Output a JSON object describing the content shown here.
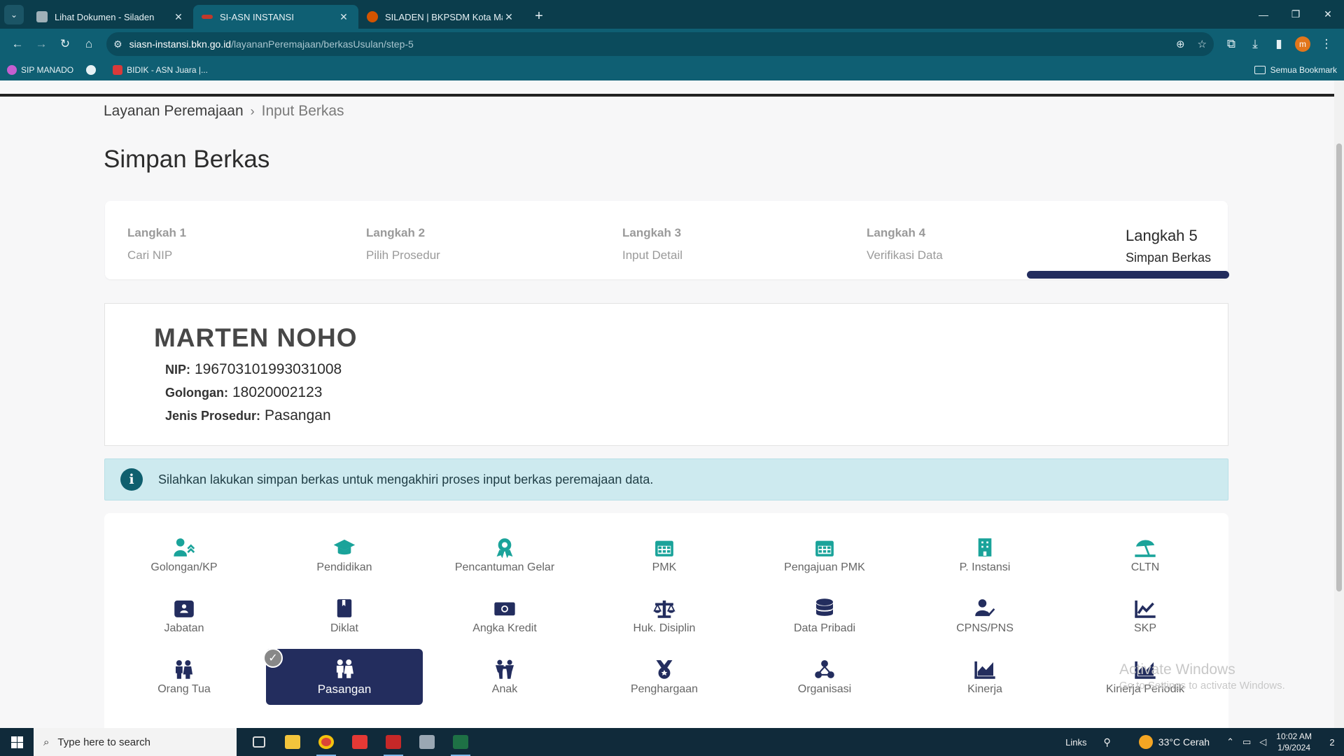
{
  "browser": {
    "tabs": [
      {
        "title": "Lihat Dokumen - Siladen",
        "active": false,
        "favicon_color": "#9fb0b8"
      },
      {
        "title": "SI-ASN INSTANSI",
        "active": true,
        "favicon_color": "#c0392b"
      },
      {
        "title": "SILADEN | BKPSDM Kota Manado",
        "active": false,
        "favicon_color": "#d35400"
      }
    ],
    "url_host": "siasn-instansi.bkn.go.id",
    "url_path": "/layananPeremajaan/berkasUsulan/step-5",
    "profile_initial": "m",
    "bookmarks": [
      {
        "label": "SIP MANADO",
        "color": "#c55fd0"
      },
      {
        "label": "",
        "color": "#e6f1f4"
      },
      {
        "label": "BIDIK - ASN Juara |...",
        "color": "#d83a3a"
      }
    ],
    "bookmarks_folder": "Semua Bookmark"
  },
  "breadcrumb": {
    "link": "Layanan Peremajaan",
    "current": "Input Berkas"
  },
  "page_title": "Simpan Berkas",
  "steps": [
    {
      "num": "Langkah 1",
      "label": "Cari NIP",
      "active": false
    },
    {
      "num": "Langkah 2",
      "label": "Pilih Prosedur",
      "active": false
    },
    {
      "num": "Langkah 3",
      "label": "Input Detail",
      "active": false
    },
    {
      "num": "Langkah 4",
      "label": "Verifikasi Data",
      "active": false
    },
    {
      "num": "Langkah 5",
      "label": "Simpan Berkas",
      "active": true
    }
  ],
  "profile": {
    "name": "MARTEN NOHO",
    "nip_label": "NIP:",
    "nip": "196703101993031008",
    "golongan_label": "Golongan:",
    "golongan": "18020002123",
    "prosedur_label": "Jenis Prosedur:",
    "prosedur": "Pasangan"
  },
  "alert": {
    "text": "Silahkan lakukan simpan berkas untuk mengakhiri proses input berkas peremajaan data."
  },
  "menu": {
    "selected": "Pasangan",
    "rows": [
      [
        {
          "label": "Golongan/KP",
          "icon": "user-up-icon",
          "color": "#1aa39a"
        },
        {
          "label": "Pendidikan",
          "icon": "graduation-cap-icon",
          "color": "#1aa39a"
        },
        {
          "label": "Pencantuman Gelar",
          "icon": "award-icon",
          "color": "#1aa39a"
        },
        {
          "label": "PMK",
          "icon": "calendar-icon",
          "color": "#1aa39a"
        },
        {
          "label": "Pengajuan PMK",
          "icon": "calendar-icon",
          "color": "#1aa39a"
        },
        {
          "label": "P. Instansi",
          "icon": "building-icon",
          "color": "#1aa39a"
        },
        {
          "label": "CLTN",
          "icon": "umbrella-beach-icon",
          "color": "#1aa39a"
        }
      ],
      [
        {
          "label": "Jabatan",
          "icon": "id-badge-icon",
          "color": "#232d5e"
        },
        {
          "label": "Diklat",
          "icon": "book-icon",
          "color": "#232d5e"
        },
        {
          "label": "Angka Kredit",
          "icon": "money-bill-icon",
          "color": "#232d5e"
        },
        {
          "label": "Huk. Disiplin",
          "icon": "balance-scale-icon",
          "color": "#232d5e"
        },
        {
          "label": "Data Pribadi",
          "icon": "database-icon",
          "color": "#232d5e"
        },
        {
          "label": "CPNS/PNS",
          "icon": "user-check-icon",
          "color": "#232d5e"
        },
        {
          "label": "SKP",
          "icon": "chart-line-icon",
          "color": "#232d5e"
        }
      ],
      [
        {
          "label": "Orang Tua",
          "icon": "parents-icon",
          "color": "#232d5e"
        },
        {
          "label": "Pasangan",
          "icon": "couple-icon",
          "color": "#ffffff"
        },
        {
          "label": "Anak",
          "icon": "child-icon",
          "color": "#232d5e"
        },
        {
          "label": "Penghargaan",
          "icon": "medal-icon",
          "color": "#232d5e"
        },
        {
          "label": "Organisasi",
          "icon": "organization-icon",
          "color": "#232d5e"
        },
        {
          "label": "Kinerja",
          "icon": "chart-area-icon",
          "color": "#232d5e"
        },
        {
          "label": "Kinerja Periodik",
          "icon": "chart-area-icon",
          "color": "#232d5e"
        }
      ]
    ]
  },
  "watermark": {
    "title": "Activate Windows",
    "subtitle": "Go to Settings to activate Windows."
  },
  "taskbar": {
    "search_placeholder": "Type here to search",
    "links": "Links",
    "weather": "33°C  Cerah",
    "time": "10:02 AM",
    "date": "1/9/2024",
    "notifications": "2"
  }
}
